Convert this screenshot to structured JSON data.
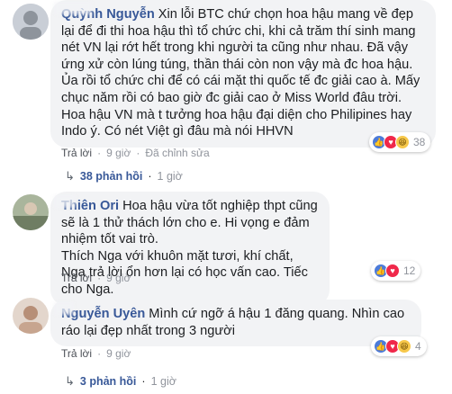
{
  "comments": [
    {
      "author": "Quỳnh Nguyễn",
      "text": "Xin lỗi BTC chứ chọn hoa hậu mang về đẹp lại để đi thi hoa hậu thì tổ chức chi, khi cả trăm thí sinh mang nét VN lại rớt hết trong khi người ta cũng như nhau. Đã vậy ứng xử còn lúng túng, thần thái còn non vậy mà đc hoa hậu. Ủa rồi tổ chức chi để có cái mặt thi quốc tế đc giải cao à. Mấy chục năm rồi có bao giờ đc giải cao ở Miss World đâu trời. Hoa hậu VN mà t tưởng hoa hậu đại diện cho Philipines hay Indo ý. Có nét Việt gì đâu mà nói HHVN",
      "reply_label": "Trả lời",
      "time": "9 giờ",
      "edited": "Đã chỉnh sửa",
      "reaction_count": "38",
      "reaction_icons": [
        "like-icon",
        "love-icon",
        "haha-icon"
      ],
      "replies": "38 phản hồi",
      "replies_time": "1 giờ"
    },
    {
      "author": "Thiên Ori",
      "text": "Hoa hậu vừa tốt nghiệp thpt cũng sẽ là 1 thử thách lớn cho e. Hi vọng e đảm nhiệm tốt vai trò.",
      "text2": "Thích Nga với khuôn mặt tươi, khí chất, Nga trả lời ổn hơn lại có học vấn cao. Tiếc cho Nga.",
      "reply_label": "Trả lời",
      "time": "9 giờ",
      "reaction_count": "12",
      "reaction_icons": [
        "like-icon",
        "love-icon"
      ]
    },
    {
      "author": "Nguyễn Uyên",
      "text": "Mình cứ ngỡ á hậu 1 đăng quang. Nhìn cao ráo lại đẹp nhất trong 3 người",
      "reply_label": "Trả lời",
      "time": "9 giờ",
      "reaction_count": "4",
      "reaction_icons": [
        "like-icon",
        "love-icon",
        "haha-icon"
      ],
      "replies": "3 phản hồi",
      "replies_time": "1 giờ"
    }
  ],
  "glyphs": {
    "like": "👍",
    "love": "♥",
    "haha": "😆",
    "reply_arrow": "↳",
    "dot": "·"
  }
}
